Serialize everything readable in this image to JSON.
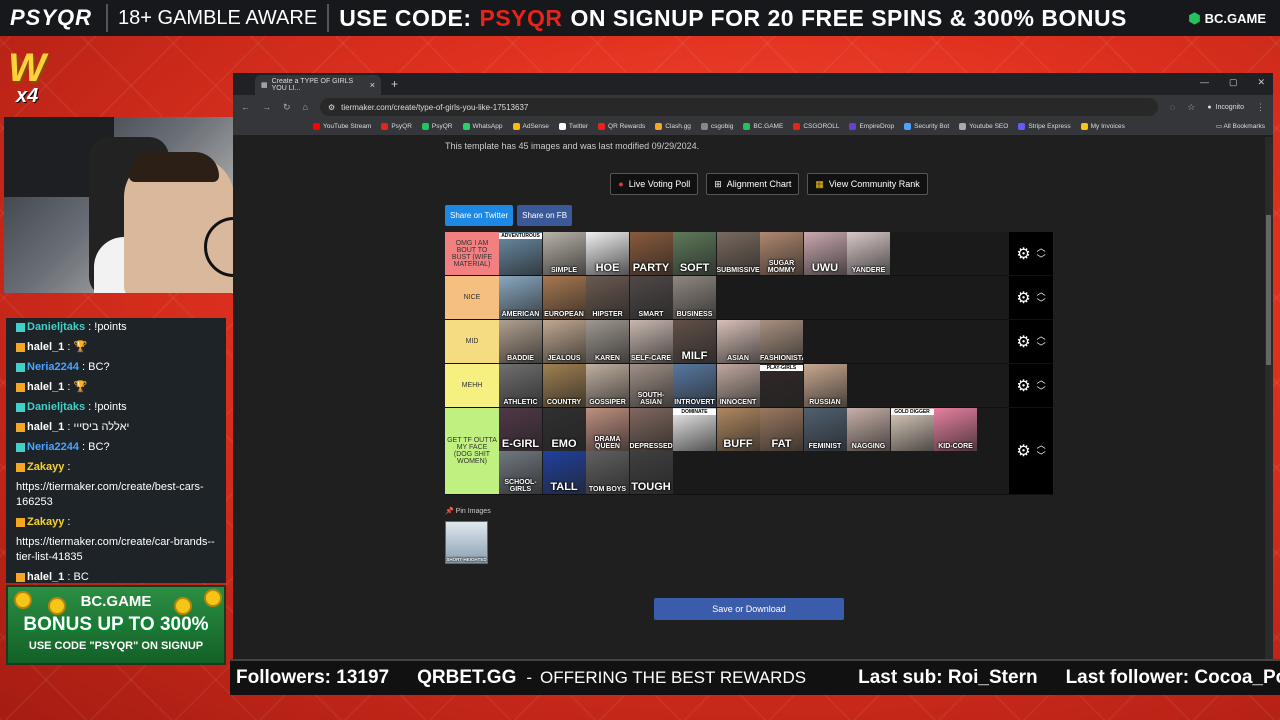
{
  "topbar": {
    "brand": "PSYQR",
    "aware": "18+ GAMBLE AWARE",
    "use_code": "USE CODE:",
    "code": "PSYQR",
    "offer": "ON SIGNUP  FOR  20 FREE SPINS & 300% BONUS",
    "sponsor": "BC.GAME"
  },
  "logo": {
    "letter": "W",
    "mult": "x4"
  },
  "chat": {
    "messages": [
      {
        "name": "Danieljtaks",
        "name_color": "#3fd0c9",
        "text": " : !points"
      },
      {
        "name": "halel_1",
        "name_color": "#ffffff",
        "text": " : 🏆"
      },
      {
        "name": "Neria2244",
        "name_color": "#4aa3ff",
        "text": " : BC?"
      },
      {
        "name": "halel_1",
        "name_color": "#ffffff",
        "text": " : 🏆"
      },
      {
        "name": "Danieljtaks",
        "name_color": "#3fd0c9",
        "text": " : !points"
      },
      {
        "name": "halel_1",
        "name_color": "#ffffff",
        "text": " : יאללה ביסייי"
      },
      {
        "name": "Neria2244",
        "name_color": "#4aa3ff",
        "text": " : BC?"
      },
      {
        "name": "Zakayy",
        "name_color": "#f3d12f",
        "text": " :"
      },
      {
        "name": "",
        "name_color": "#ffffff",
        "text": "https://tiermaker.com/create/best-cars-166253"
      },
      {
        "name": "Zakayy",
        "name_color": "#f3d12f",
        "text": " :"
      },
      {
        "name": "",
        "name_color": "#ffffff",
        "text": "https://tiermaker.com/create/car-brands--tier-list-41835"
      },
      {
        "name": "halel_1",
        "name_color": "#ffffff",
        "text": " : BC"
      }
    ]
  },
  "ad": {
    "brand": "BC.GAME",
    "bonus": "BONUS UP TO 300%",
    "code": "USE CODE \"PSYQR\" ON SIGNUP"
  },
  "browser": {
    "tab_title": "Create a TYPE OF GIRLS YOU LI...",
    "url": "tiermaker.com/create/type-of-girls-you-like-17513637",
    "incognito": "Incognito",
    "bookmarks": [
      {
        "label": "YouTube Stream",
        "color": "#ff0000"
      },
      {
        "label": "PsyQR",
        "color": "#e8231a"
      },
      {
        "label": "PsyQR",
        "color": "#24c25e"
      },
      {
        "label": "WhatsApp",
        "color": "#25d366"
      },
      {
        "label": "AdSense",
        "color": "#fbbc05"
      },
      {
        "label": "Twitter",
        "color": "#ffffff"
      },
      {
        "label": "QR Rewards",
        "color": "#e8231a"
      },
      {
        "label": "Clash.gg",
        "color": "#f5a623"
      },
      {
        "label": "csgobig",
        "color": "#888888"
      },
      {
        "label": "BC.GAME",
        "color": "#24c25e"
      },
      {
        "label": "CSGOROLL",
        "color": "#e8231a"
      },
      {
        "label": "EmpireDrop",
        "color": "#6a3fd0"
      },
      {
        "label": "Security Bot",
        "color": "#4aa3ff"
      },
      {
        "label": "Youtube SEO",
        "color": "#aaaaaa"
      },
      {
        "label": "Stripe Express",
        "color": "#635bff"
      },
      {
        "label": "My Invoices",
        "color": "#f5c518"
      }
    ],
    "all_bookmarks": "All Bookmarks"
  },
  "page": {
    "info": "This template has 45 images and was last modified 09/29/2024.",
    "buttons": {
      "voting": "Live Voting Poll",
      "alignment": "Alignment Chart",
      "community": "View Community Rank"
    },
    "share_twitter": "Share on Twitter",
    "share_fb": "Share on FB",
    "pin_label": "Pin Images",
    "pin_image": "SHORT-HEIGHTED",
    "save": "Save or Download"
  },
  "tiers": [
    {
      "label": "OMG I AM BOUT TO BUST (WIFE MATERIAL)",
      "color": "#f28080",
      "items": [
        {
          "t": "ADVENTUROUS",
          "s": "top",
          "c": "#6b8fa8"
        },
        {
          "t": "SIMPLE",
          "s": "",
          "c": "#b9b3a8"
        },
        {
          "t": "HOE",
          "s": "big",
          "c": "#f0f0f0"
        },
        {
          "t": "PARTY",
          "s": "big",
          "c": "#8a5a3c"
        },
        {
          "t": "SOFT",
          "s": "big",
          "c": "#5d7a5a"
        },
        {
          "t": "SUBMISSIVE",
          "s": "",
          "c": "#7a6a60"
        },
        {
          "t": "SUGAR MOMMY",
          "s": "",
          "c": "#b08870"
        },
        {
          "t": "UWU",
          "s": "big",
          "c": "#c9a9b0"
        },
        {
          "t": "YANDERE",
          "s": "",
          "c": "#d8c8c8"
        }
      ]
    },
    {
      "label": "NICE",
      "color": "#f5bf80",
      "items": [
        {
          "t": "AMERICAN",
          "s": "",
          "c": "#8aa8c0"
        },
        {
          "t": "EUROPEAN",
          "s": "",
          "c": "#a87850"
        },
        {
          "t": "HIPSTER",
          "s": "",
          "c": "#6a5a50"
        },
        {
          "t": "SMART",
          "s": "",
          "c": "#504848"
        },
        {
          "t": "BUSINESS",
          "s": "",
          "c": "#908880"
        }
      ]
    },
    {
      "label": "MID",
      "color": "#f5dc80",
      "items": [
        {
          "t": "BADDIE",
          "s": "",
          "c": "#b0a090"
        },
        {
          "t": "JEALOUS",
          "s": "",
          "c": "#c0a890"
        },
        {
          "t": "KAREN",
          "s": "",
          "c": "#a09890"
        },
        {
          "t": "SELF-CARE",
          "s": "",
          "c": "#c8b8b0"
        },
        {
          "t": "MILF",
          "s": "big",
          "c": "#605048"
        },
        {
          "t": "ASIAN",
          "s": "",
          "c": "#d8c0b8"
        },
        {
          "t": "FASHIONISTA",
          "s": "",
          "c": "#a89080"
        }
      ]
    },
    {
      "label": "MEHH",
      "color": "#f5f080",
      "items": [
        {
          "t": "ATHLETIC",
          "s": "",
          "c": "#707070"
        },
        {
          "t": "COUNTRY",
          "s": "",
          "c": "#a08050"
        },
        {
          "t": "GOSSIPER",
          "s": "",
          "c": "#c0b0a0"
        },
        {
          "t": "SOUTH-ASIAN",
          "s": "",
          "c": "#a09088"
        },
        {
          "t": "INTROVERT",
          "s": "",
          "c": "#5878a0"
        },
        {
          "t": "INNOCENT",
          "s": "",
          "c": "#c0a8a0"
        },
        {
          "t": "PLAY-GIRLS",
          "s": "top",
          "c": "#302828"
        },
        {
          "t": "RUSSIAN",
          "s": "",
          "c": "#c8a890"
        }
      ]
    },
    {
      "label": "GET TF OUTTA MY FACE (DOG SHIT WOMEN)",
      "color": "#c0f080",
      "items": [
        {
          "t": "E-GIRL",
          "s": "big",
          "c": "#503848"
        },
        {
          "t": "EMO",
          "s": "big",
          "c": "#303030"
        },
        {
          "t": "DRAMA QUEEN",
          "s": "",
          "c": "#c09080"
        },
        {
          "t": "DEPRESSED",
          "s": "",
          "c": "#806860"
        },
        {
          "t": "DOMINATE",
          "s": "top",
          "c": "#f0f0f0"
        },
        {
          "t": "BUFF",
          "s": "big",
          "c": "#b08860"
        },
        {
          "t": "FAT",
          "s": "big",
          "c": "#9a7860"
        },
        {
          "t": "FEMINIST",
          "s": "",
          "c": "#506070"
        },
        {
          "t": "NAGGING",
          "s": "",
          "c": "#c8b0a8"
        },
        {
          "t": "GOLD DIGGER",
          "s": "top",
          "c": "#e0d0c0"
        },
        {
          "t": "KID-CORE",
          "s": "",
          "c": "#e880a0"
        },
        {
          "t": "SCHOOL-GIRLS",
          "s": "",
          "c": "#707880"
        },
        {
          "t": "TALL",
          "s": "big",
          "c": "#2040a0"
        },
        {
          "t": "TOM BOYS",
          "s": "",
          "c": "#606060"
        },
        {
          "t": "TOUGH",
          "s": "big",
          "c": "#404040"
        }
      ]
    }
  ],
  "ticker": {
    "followers": "Followers: 13197",
    "site": "QRBET.GG",
    "sep": "-",
    "tag": "OFFERING THE BEST REWARDS",
    "last_sub": "Last sub: Roi_Stern",
    "last_follower": "Last follower: Cocoa_Poofs"
  }
}
